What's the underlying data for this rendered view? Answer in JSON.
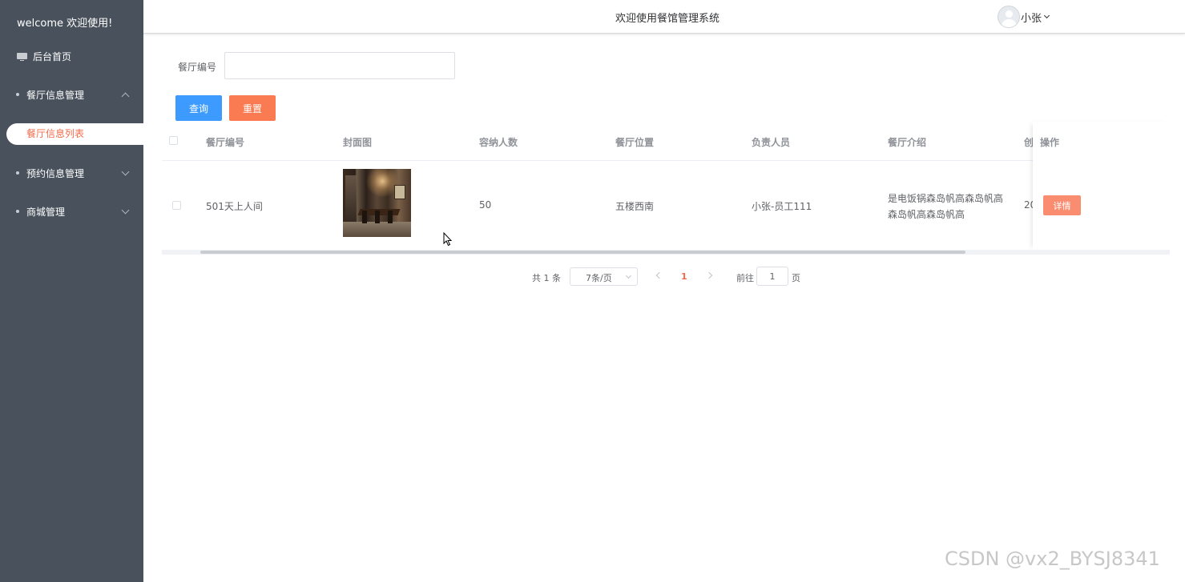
{
  "sidebar": {
    "welcome": "welcome 欢迎使用!",
    "home": "后台首页",
    "groups": [
      {
        "label": "餐厅信息管理",
        "expanded": true
      },
      {
        "label": "预约信息管理",
        "expanded": false
      },
      {
        "label": "商城管理",
        "expanded": false
      }
    ],
    "active_item": "餐厅信息列表"
  },
  "header": {
    "title": "欢迎使用餐馆管理系统",
    "user": "小张"
  },
  "search": {
    "label": "餐厅编号",
    "value": "",
    "query_button": "查询",
    "reset_button": "重置"
  },
  "table": {
    "columns": [
      "餐厅编号",
      "封面图",
      "容纳人数",
      "餐厅位置",
      "负责人员",
      "餐厅介绍",
      "创",
      "操作"
    ],
    "rows": [
      {
        "id": "501天上人间",
        "capacity": "50",
        "location": "五楼西南",
        "staff": "小张-员工111",
        "intro_line1": "是电饭锅森岛帆高森岛帆高",
        "intro_line2": "森岛帆高森岛帆高",
        "created_partial": "20",
        "detail_button": "详情"
      }
    ]
  },
  "pagination": {
    "total": "共 1 条",
    "page_size": "7条/页",
    "current_page": "1",
    "goto_label": "前往",
    "goto_value": "1",
    "page_suffix": "页"
  },
  "watermark": "CSDN @vx2_BYSJ8341",
  "colors": {
    "sidebar_bg": "#49525c",
    "primary": "#3d9bff",
    "accent": "#fa7b52",
    "active_text": "#f06b4a"
  }
}
